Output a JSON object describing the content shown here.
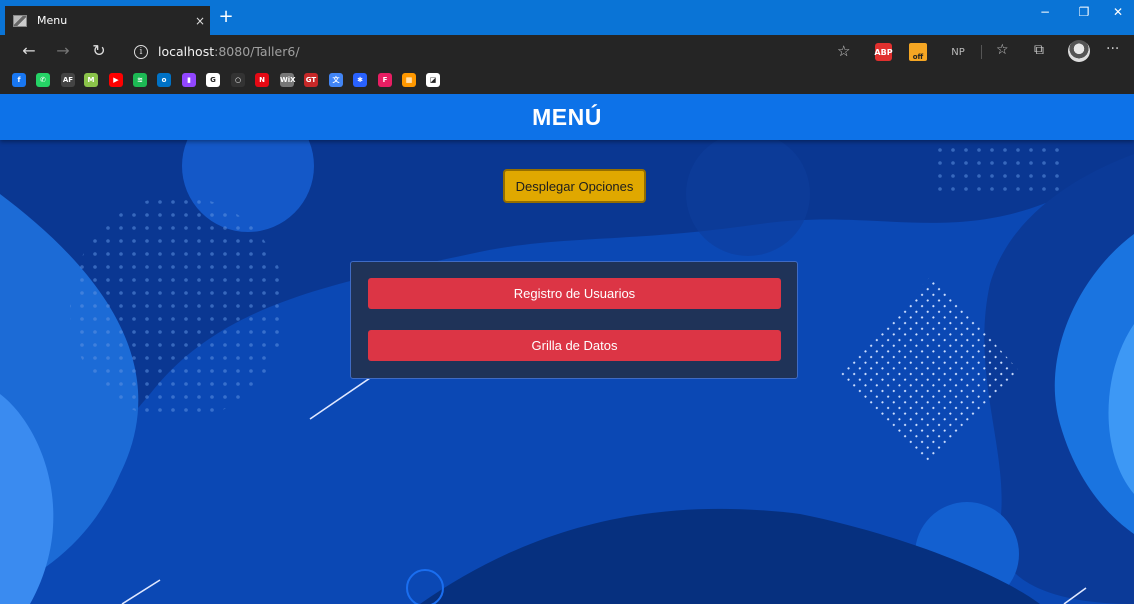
{
  "browser": {
    "tab": {
      "title": "Menu",
      "close_symbol": "×"
    },
    "new_tab_symbol": "+",
    "window_controls": {
      "minimize": "−",
      "restore": "❐",
      "close": "✕"
    },
    "address": {
      "host": "localhost",
      "rest": ":8080/Taller6/"
    },
    "extensions": [
      "ABP",
      "off",
      "NP"
    ],
    "more_symbol": "···",
    "bookmarks": [
      {
        "icon": "facebook-icon",
        "text": "f",
        "color": "#1877f2"
      },
      {
        "icon": "whatsapp-icon",
        "text": "✆",
        "color": "#25d366"
      },
      {
        "icon": "af-icon",
        "text": "AF",
        "color": "#444444"
      },
      {
        "icon": "m-icon",
        "text": "M",
        "color": "#8bc34a"
      },
      {
        "icon": "youtube-icon",
        "text": "▶",
        "color": "#ff0000"
      },
      {
        "icon": "spotify-icon",
        "text": "≋",
        "color": "#1db954"
      },
      {
        "icon": "outlook-icon",
        "text": "o",
        "color": "#0072c6"
      },
      {
        "icon": "twitch-icon",
        "text": "▮",
        "color": "#9146ff"
      },
      {
        "icon": "google-icon",
        "text": "G",
        "color": "#ffffff"
      },
      {
        "icon": "github-icon",
        "text": "○",
        "color": "#333333"
      },
      {
        "icon": "netflix-icon",
        "text": "N",
        "color": "#e50914"
      },
      {
        "icon": "wix-icon",
        "text": "WiX",
        "color": "#777777"
      },
      {
        "icon": "gt-icon",
        "text": "GT",
        "color": "#c62828"
      },
      {
        "icon": "translate-icon",
        "text": "文",
        "color": "#4285f4"
      },
      {
        "icon": "devtools-icon",
        "text": "✱",
        "color": "#2962ff"
      },
      {
        "icon": "f-icon",
        "text": "F",
        "color": "#e91e63"
      },
      {
        "icon": "apps-icon",
        "text": "▦",
        "color": "#ff9800"
      },
      {
        "icon": "photo-icon",
        "text": "◪",
        "color": "#ffffff"
      }
    ]
  },
  "page": {
    "title": "MENÚ",
    "toggle_button": "Desplegar Opciones",
    "options": [
      "Registro de Usuarios",
      "Grilla de Datos"
    ]
  },
  "colors": {
    "header": "#0d72e8",
    "toggle_button": "#e0a800",
    "option_button": "#dc3545",
    "panel": "#1f3358"
  }
}
